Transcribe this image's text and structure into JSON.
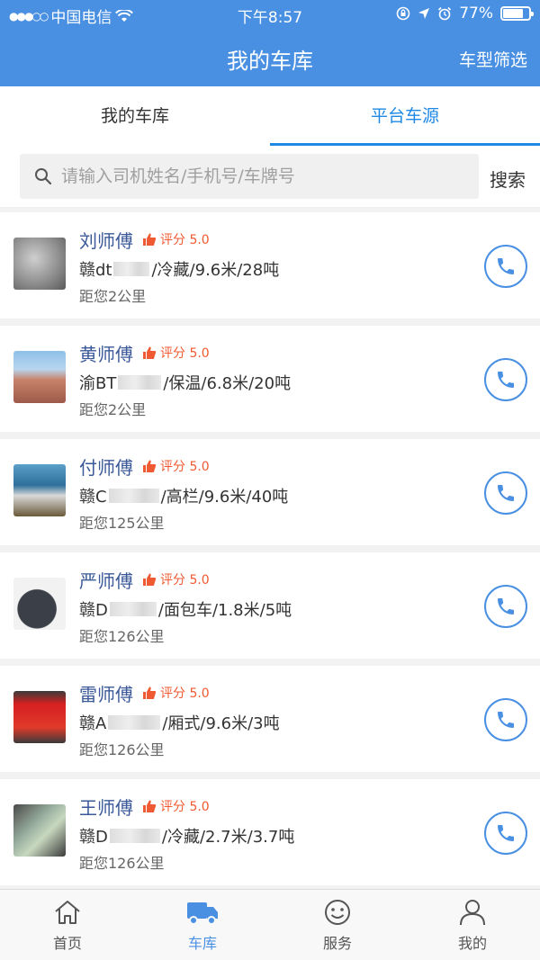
{
  "status": {
    "carrier": "中国电信",
    "time": "下午8:57",
    "battery": "77%",
    "battery_level": 0.77
  },
  "header": {
    "title": "我的车库",
    "filter_label": "车型筛选"
  },
  "tabs": [
    {
      "label": "我的车库"
    },
    {
      "label": "平台车源"
    }
  ],
  "search": {
    "placeholder": "请输入司机姓名/手机号/车牌号",
    "button_label": "搜索"
  },
  "drivers": [
    {
      "name": "刘师傅",
      "rating": "评分 5.0",
      "plate_prefix": "赣dt",
      "details": "/冷藏/9.6米/28吨",
      "distance": "距您2公里"
    },
    {
      "name": "黄师傅",
      "rating": "评分 5.0",
      "plate_prefix": "渝BT",
      "details": "/保温/6.8米/20吨",
      "distance": "距您2公里"
    },
    {
      "name": "付师傅",
      "rating": "评分 5.0",
      "plate_prefix": "赣C",
      "details": "/高栏/9.6米/40吨",
      "distance": "距您125公里"
    },
    {
      "name": "严师傅",
      "rating": "评分 5.0",
      "plate_prefix": "赣D",
      "details": "/面包车/1.8米/5吨",
      "distance": "距您126公里"
    },
    {
      "name": "雷师傅",
      "rating": "评分 5.0",
      "plate_prefix": "赣A",
      "details": "/厢式/9.6米/3吨",
      "distance": "距您126公里"
    },
    {
      "name": "王师傅",
      "rating": "评分 5.0",
      "plate_prefix": "赣D",
      "details": "/冷藏/2.7米/3.7吨",
      "distance": "距您126公里"
    }
  ],
  "bottom_nav": [
    {
      "label": "首页"
    },
    {
      "label": "车库"
    },
    {
      "label": "服务"
    },
    {
      "label": "我的"
    }
  ],
  "colors": {
    "primary": "#4a90e2",
    "rating": "#f05a32",
    "name": "#3b5998"
  }
}
